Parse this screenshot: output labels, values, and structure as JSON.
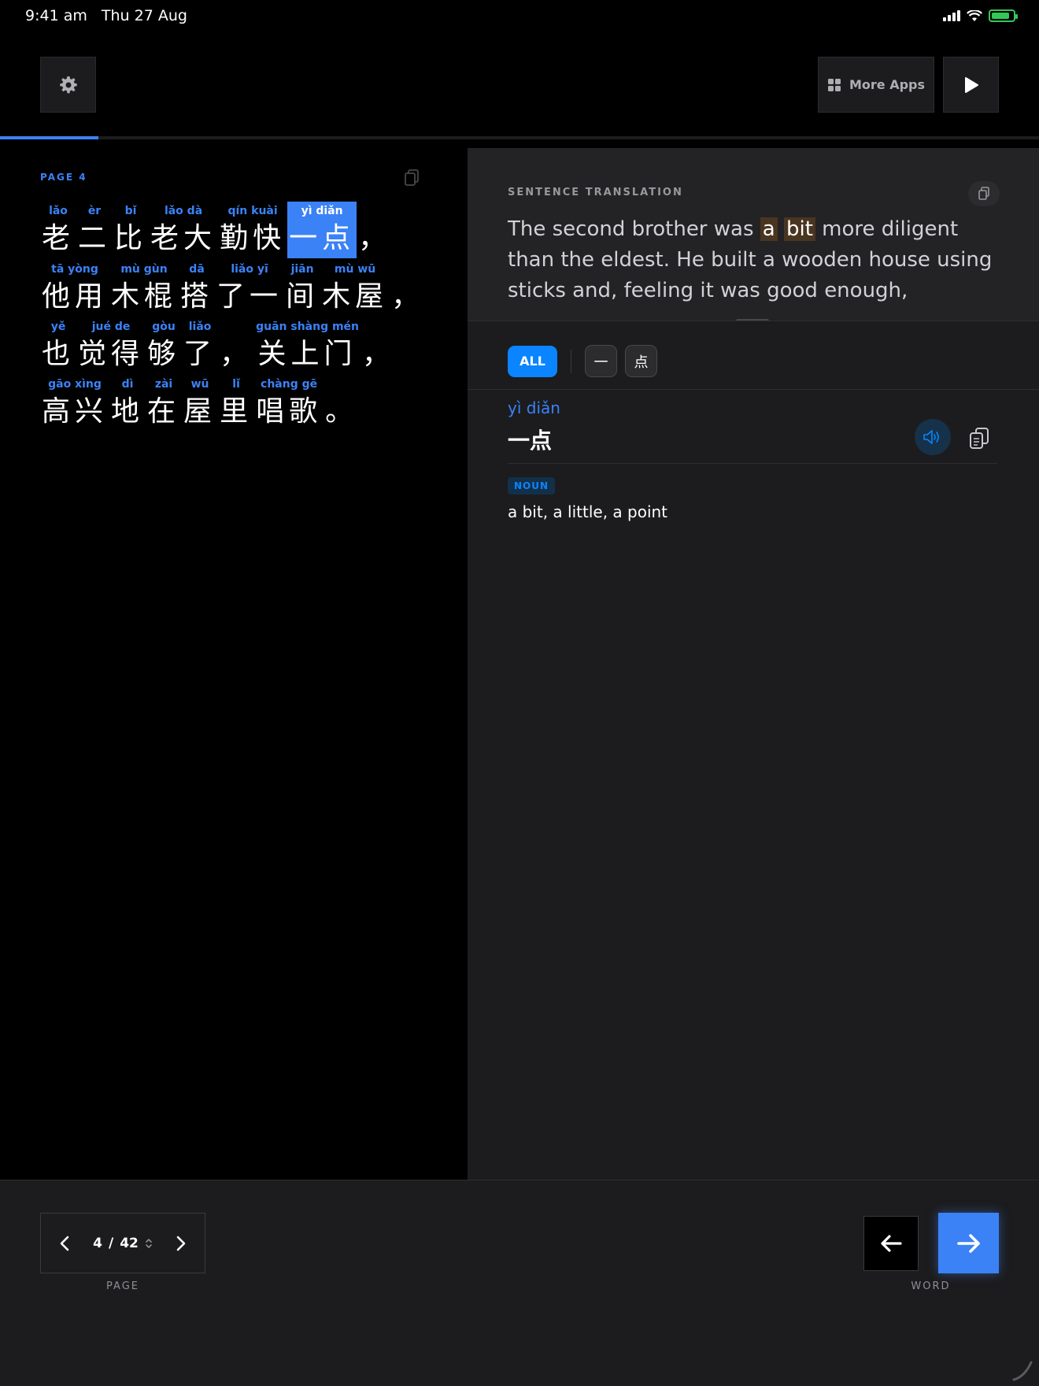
{
  "status": {
    "time": "9:41 am",
    "date": "Thu 27 Aug"
  },
  "header": {
    "more_apps": "More Apps",
    "reading_progress": 0.095
  },
  "reader": {
    "page_label": "PAGE 4",
    "lines": [
      [
        {
          "py": "lǎo",
          "hz": "老"
        },
        {
          "py": "èr",
          "hz": "二"
        },
        {
          "py": "bǐ",
          "hz": "比"
        },
        {
          "py": "lǎo dà",
          "hz": "老大"
        },
        {
          "py": "qín kuài",
          "hz": "勤快"
        },
        {
          "py": "yì diǎn",
          "hz": "一点",
          "selected": true
        },
        {
          "py": "",
          "hz": "，"
        }
      ],
      [
        {
          "py": "tā yòng",
          "hz": "他用"
        },
        {
          "py": "mù gùn",
          "hz": "木棍"
        },
        {
          "py": "dā",
          "hz": "搭"
        },
        {
          "py": "liǎo yī",
          "hz": "了一"
        },
        {
          "py": "jiān",
          "hz": "间"
        },
        {
          "py": "mù wū",
          "hz": "木屋"
        },
        {
          "py": "",
          "hz": "，"
        }
      ],
      [
        {
          "py": "yě",
          "hz": "也"
        },
        {
          "py": "jué de",
          "hz": "觉得"
        },
        {
          "py": "gòu",
          "hz": "够"
        },
        {
          "py": "liǎo",
          "hz": "了"
        },
        {
          "py": "",
          "hz": "，"
        },
        {
          "py": "guān shàng mén",
          "hz": "关上门"
        },
        {
          "py": "",
          "hz": "，"
        }
      ],
      [
        {
          "py": "gāo xìng",
          "hz": "高兴"
        },
        {
          "py": "dì",
          "hz": "地"
        },
        {
          "py": "zài",
          "hz": "在"
        },
        {
          "py": "wū",
          "hz": "屋"
        },
        {
          "py": "lǐ",
          "hz": "里"
        },
        {
          "py": "chàng gē",
          "hz": "唱歌"
        },
        {
          "py": "",
          "hz": "。"
        }
      ]
    ]
  },
  "translation": {
    "label": "SENTENCE TRANSLATION",
    "before": "The second brother was ",
    "hl1": "a",
    "hl2": "bit",
    "after": " more diligent than the eldest. He built a wooden house using sticks and, feeling it was good enough,"
  },
  "filters": {
    "all": "ALL",
    "chars": [
      "一",
      "点"
    ]
  },
  "entry": {
    "pinyin": "yì diǎn",
    "hanzi": "一点",
    "pos": "NOUN",
    "definition": "a bit, a little, a point"
  },
  "bottom": {
    "page_current": "4",
    "page_sep": "/",
    "page_total": "42",
    "page_label": "PAGE",
    "word_label": "WORD"
  }
}
